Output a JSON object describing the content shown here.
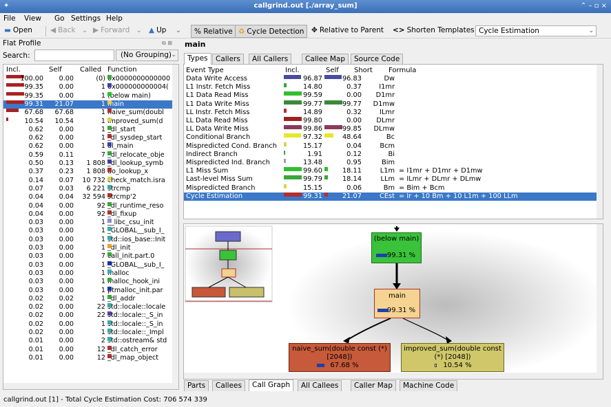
{
  "window": {
    "title": "callgrind.out [./array_sum]",
    "controls": "⌃ – ▫ ×"
  },
  "menubar": [
    "File",
    "View",
    "Go",
    "Settings",
    "Help"
  ],
  "toolbar": {
    "open": "Open",
    "back": "Back",
    "forward": "Forward",
    "up": "Up",
    "relative": "% Relative",
    "cycle_detection": "Cycle Detection",
    "relative_to_parent": "Relative to Parent",
    "shorten_templates": "Shorten Templates",
    "cost_type": "Cycle Estimation"
  },
  "flat_profile": {
    "title": "Flat Profile",
    "search_label": "Search:",
    "search_value": "",
    "grouping": "(No Grouping)",
    "columns": [
      "Incl.",
      "Self",
      "Called",
      "Function"
    ],
    "rows": [
      {
        "incl": "100.00",
        "self": "0.00",
        "called": "(0)",
        "fn": "0x0000000000000",
        "color": "#3aa63a",
        "bar": 1.0
      },
      {
        "incl": "99.35",
        "self": "0.00",
        "called": "1",
        "fn": "0x000000000004(",
        "color": "#3f3fa8",
        "bar": 0.99
      },
      {
        "incl": "99.35",
        "self": "0.00",
        "called": "1",
        "fn": "(below main)",
        "color": "#2fbf2f",
        "bar": 0.99
      },
      {
        "incl": "99.31",
        "self": "21.07",
        "called": "1",
        "fn": "main",
        "color": "#e9c95a",
        "bar": 0.99,
        "selected": true
      },
      {
        "incl": "67.68",
        "self": "67.68",
        "called": "1",
        "fn": "naive_sum(doubl",
        "color": "#b03030",
        "bar": 0.68
      },
      {
        "incl": "10.54",
        "self": "10.54",
        "called": "1",
        "fn": "improved_sum(d",
        "color": "#d6d64a",
        "bar": 0.1
      },
      {
        "incl": "0.62",
        "self": "0.00",
        "called": "1",
        "fn": "_dl_start",
        "color": "#3aa63a"
      },
      {
        "incl": "0.62",
        "self": "0.00",
        "called": "1",
        "fn": "_dl_sysdep_start",
        "color": "#b03030"
      },
      {
        "incl": "0.62",
        "self": "0.00",
        "called": "1",
        "fn": "dl_main",
        "color": "#3f3fa8"
      },
      {
        "incl": "0.59",
        "self": "0.11",
        "called": "7",
        "fn": "_dl_relocate_obje",
        "color": "#3aa63a"
      },
      {
        "incl": "0.50",
        "self": "0.13",
        "called": "1 808",
        "fn": "_dl_lookup_symb",
        "color": "#3f3fa8"
      },
      {
        "incl": "0.37",
        "self": "0.23",
        "called": "1 808",
        "fn": "do_lookup_x",
        "color": "#b03030"
      },
      {
        "incl": "0.14",
        "self": "0.07",
        "called": "10 732",
        "fn": "check_match.isra",
        "color": "#d6d64a"
      },
      {
        "incl": "0.07",
        "self": "0.03",
        "called": "6 221",
        "fn": "strcmp",
        "color": "#3fa8a8"
      },
      {
        "incl": "0.04",
        "self": "0.04",
        "called": "32 594",
        "fn": "strcmp'2",
        "color": "#b03030"
      },
      {
        "incl": "0.04",
        "self": "0.00",
        "called": "92",
        "fn": "_dl_runtime_reso",
        "color": "#3aa63a"
      },
      {
        "incl": "0.04",
        "self": "0.00",
        "called": "92",
        "fn": "_dl_fixup",
        "color": "#b03030"
      },
      {
        "incl": "0.03",
        "self": "0.00",
        "called": "1",
        "fn": "__libc_csu_init",
        "color": "#8a8ad6"
      },
      {
        "incl": "0.03",
        "self": "0.00",
        "called": "1",
        "fn": "_GLOBAL__sub_I_",
        "color": "#3fa8a8"
      },
      {
        "incl": "0.03",
        "self": "0.00",
        "called": "1",
        "fn": "std::ios_base::Init",
        "color": "#3fa8a8"
      },
      {
        "incl": "0.03",
        "self": "0.00",
        "called": "1",
        "fn": "_dl_init",
        "color": "#e9a02f"
      },
      {
        "incl": "0.03",
        "self": "0.00",
        "called": "7",
        "fn": "call_init.part.0",
        "color": "#3aa63a"
      },
      {
        "incl": "0.03",
        "self": "0.00",
        "called": "1",
        "fn": "_GLOBAL__sub_I_",
        "color": "#1d2fb0"
      },
      {
        "incl": "0.03",
        "self": "0.00",
        "called": "1",
        "fn": "malloc",
        "color": "#3fa8a8"
      },
      {
        "incl": "0.03",
        "self": "0.00",
        "called": "1",
        "fn": "malloc_hook_ini",
        "color": "#3aa63a"
      },
      {
        "incl": "0.03",
        "self": "0.00",
        "called": "1",
        "fn": "ptmalloc_init.par",
        "color": "#1d2fb0"
      },
      {
        "incl": "0.02",
        "self": "0.02",
        "called": "1",
        "fn": "_dl_addr",
        "color": "#3aa63a"
      },
      {
        "incl": "0.02",
        "self": "0.00",
        "called": "22",
        "fn": "std::locale::locale",
        "color": "#3fa8a8"
      },
      {
        "incl": "0.02",
        "self": "0.00",
        "called": "22",
        "fn": "std::locale::_S_in",
        "color": "#5a3fa8"
      },
      {
        "incl": "0.02",
        "self": "0.00",
        "called": "1",
        "fn": "std::locale::_S_in",
        "color": "#3fa8a8"
      },
      {
        "incl": "0.02",
        "self": "0.00",
        "called": "1",
        "fn": "std::locale::_Impl",
        "color": "#3fa8a8"
      },
      {
        "incl": "0.01",
        "self": "0.00",
        "called": "2",
        "fn": "std::ostream& std",
        "color": "#3fa8a8"
      },
      {
        "incl": "0.01",
        "self": "0.00",
        "called": "12",
        "fn": "_dl_catch_error",
        "color": "#b03030"
      },
      {
        "incl": "0.01",
        "self": "0.00",
        "called": "12",
        "fn": "_dl_map_object",
        "color": "#b03030"
      }
    ]
  },
  "main_panel": {
    "title": "main",
    "top_tabs": [
      "Types",
      "Callers",
      "All Callers",
      "Callee Map",
      "Source Code"
    ],
    "top_active": 0,
    "types_columns": [
      "Event Type",
      "Incl.",
      "Self",
      "Short",
      "Formula"
    ],
    "types_rows": [
      {
        "event": "Data Write Access",
        "incl": "96.87",
        "self": "96.83",
        "short": "Dw",
        "formula": "",
        "color": "#4a4aa0",
        "bar": 0.97,
        "sbar": 0.97
      },
      {
        "event": "L1 Instr. Fetch Miss",
        "incl": "14.80",
        "self": "0.37",
        "short": "I1mr",
        "formula": "",
        "color": "#3aa63a",
        "bar": 0.15,
        "sbar": 0
      },
      {
        "event": "L1 Data Read Miss",
        "incl": "99.59",
        "self": "0.00",
        "short": "D1mr",
        "formula": "",
        "color": "#2fbf2f",
        "bar": 1.0,
        "sbar": 0
      },
      {
        "event": "L1 Data Write Miss",
        "incl": "99.77",
        "self": "99.77",
        "short": "D1mw",
        "formula": "",
        "color": "#3a8a3a",
        "bar": 1.0,
        "sbar": 1.0
      },
      {
        "event": "LL Instr. Fetch Miss",
        "incl": "14.89",
        "self": "0.32",
        "short": "ILmr",
        "formula": "",
        "color": "#b03030",
        "bar": 0.15,
        "sbar": 0
      },
      {
        "event": "LL Data Read Miss",
        "incl": "99.80",
        "self": "0.00",
        "short": "DLmr",
        "formula": "",
        "color": "#a02020",
        "bar": 1.0,
        "sbar": 0
      },
      {
        "event": "LL Data Write Miss",
        "incl": "99.86",
        "self": "99.85",
        "short": "DLmw",
        "formula": "",
        "color": "#8a3a5a",
        "bar": 1.0,
        "sbar": 1.0
      },
      {
        "event": "Conditional Branch",
        "incl": "97.32",
        "self": "48.64",
        "short": "Bc",
        "formula": "",
        "color": "#e6e62a",
        "bar": 0.97,
        "sbar": 0.49
      },
      {
        "event": "Mispredicted Cond. Branch",
        "incl": "15.17",
        "self": "0.04",
        "short": "Bcm",
        "formula": "",
        "color": "#d6d64a",
        "bar": 0.15,
        "sbar": 0
      },
      {
        "event": "Indirect Branch",
        "incl": "1.91",
        "self": "0.12",
        "short": "Bi",
        "formula": "",
        "color": "#3aa63a",
        "bar": 0.02,
        "sbar": 0
      },
      {
        "event": "Mispredicted Ind. Branch",
        "incl": "13.48",
        "self": "0.95",
        "short": "Bim",
        "formula": "",
        "color": "#a0a0a0",
        "bar": 0.13,
        "sbar": 0
      },
      {
        "event": "L1 Miss Sum",
        "incl": "99.60",
        "self": "18.11",
        "short": "L1m",
        "formula": "= I1mr + D1mr + D1mw",
        "color": "#2fbf2f",
        "bar": 1.0,
        "sbar": 0.18
      },
      {
        "event": "Last-level Miss Sum",
        "incl": "99.79",
        "self": "18.14",
        "short": "LLm",
        "formula": "= ILmr + DLmr + DLmw",
        "color": "#3aa63a",
        "bar": 1.0,
        "sbar": 0.18
      },
      {
        "event": "Mispredicted Branch",
        "incl": "15.15",
        "self": "0.06",
        "short": "Bm",
        "formula": "= Bim + Bcm",
        "color": "#d6d64a",
        "bar": 0.15,
        "sbar": 0
      },
      {
        "event": "Cycle Estimation",
        "incl": "99.31",
        "self": "21.07",
        "short": "CEst",
        "formula": "= Ir + 10 Bm + 10 L1m + 100 LLm",
        "color": "#b03030",
        "bar": 0.99,
        "sbar": 0.21,
        "selected": true
      }
    ],
    "bottom_tabs": [
      "Parts",
      "Callees",
      "Call Graph",
      "All Callees",
      "Caller Map",
      "Machine Code"
    ],
    "bottom_active": 2,
    "graph": {
      "below_main": {
        "label": "(below main)",
        "pct": "99.31 %",
        "fill": 0.99
      },
      "main": {
        "label": "main",
        "pct": "99.31 %",
        "fill": 0.99
      },
      "naive": {
        "label": "naive_sum(double const (*)",
        "label2": "[2048])",
        "pct": "67.68 %",
        "fill": 0.68
      },
      "improved": {
        "label": "improved_sum(double const",
        "label2": "(*) [2048])",
        "pct": "10.54 %",
        "fill": 0.11
      }
    }
  },
  "status": "callgrind.out [1] - Total Cycle Estimation Cost: 706 574 339",
  "colors": {
    "selection": "#3b78c8",
    "title_bar": "#3a6fb8"
  }
}
